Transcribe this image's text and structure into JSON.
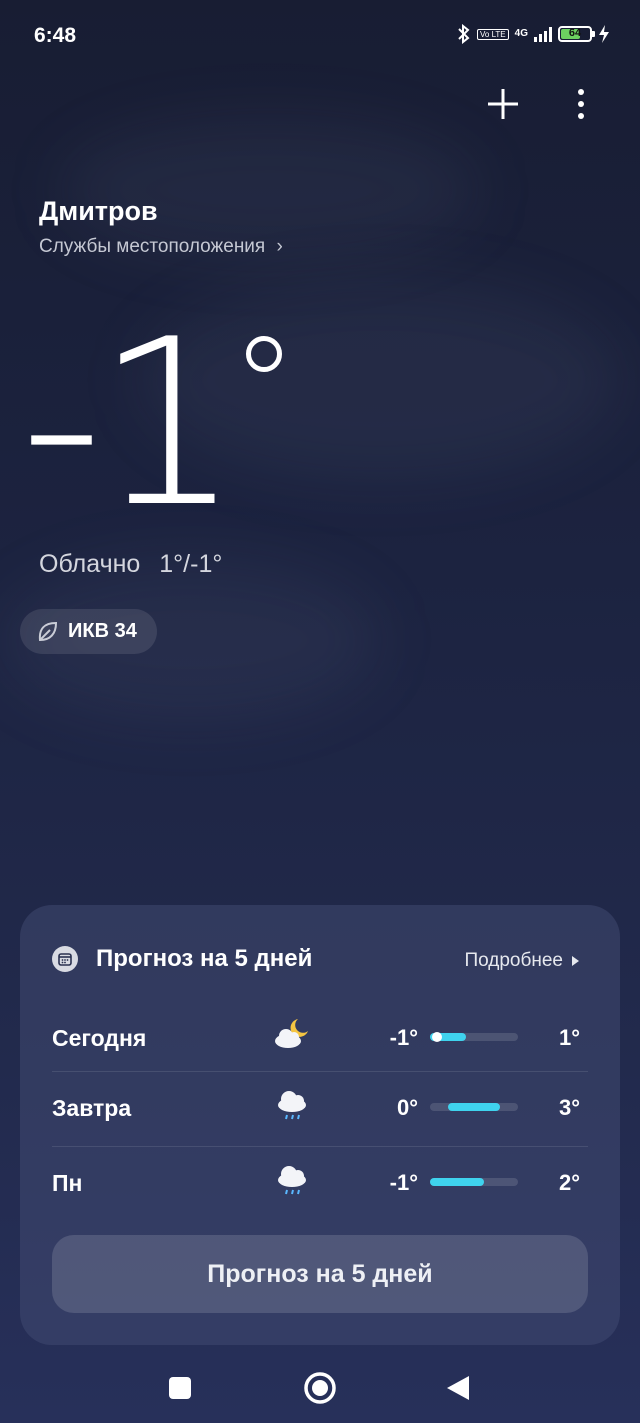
{
  "status": {
    "time": "6:48",
    "net_top": "4G",
    "volte": "Vo LTE",
    "battery": "64"
  },
  "location": {
    "city": "Дмитров",
    "service": "Службы местоположения",
    "service_arrow": "›"
  },
  "current": {
    "temp": "-1",
    "condition": "Облачно",
    "range": "1°/-1°"
  },
  "aqi": {
    "label": "ИКВ 34"
  },
  "forecast": {
    "title": "Прогноз на 5 дней",
    "more": "Подробнее",
    "button": "Прогноз на 5 дней",
    "days": [
      {
        "day": "Сегодня",
        "icon": "partly-cloudy-night-icon",
        "low": "-1°",
        "high": "1°"
      },
      {
        "day": "Завтра",
        "icon": "rain-cloud-icon",
        "low": "0°",
        "high": "3°"
      },
      {
        "day": "Пн",
        "icon": "rain-cloud-icon",
        "low": "-1°",
        "high": "2°"
      }
    ]
  },
  "colors": {
    "accent_bar": "#3fd3ee",
    "battery": "#6cd160",
    "background": "#1c2340"
  }
}
